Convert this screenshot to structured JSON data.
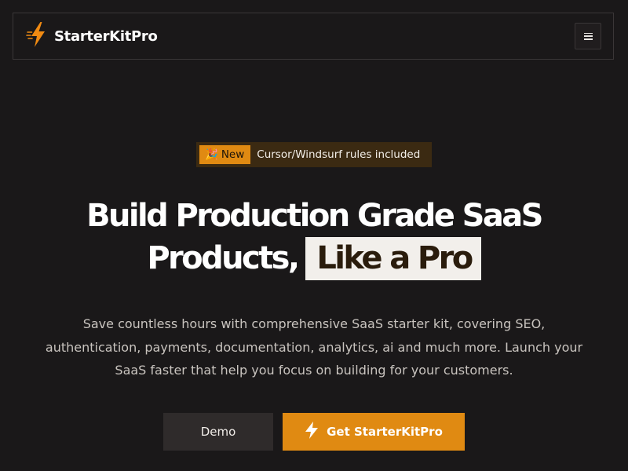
{
  "navbar": {
    "brand_name": "StarterKitPro",
    "menu_icon": "hamburger-menu-icon"
  },
  "badge": {
    "tag_emoji": "🎉",
    "tag_label": "New",
    "text": "Cursor/Windsurf rules included"
  },
  "hero": {
    "headline_line1": "Build Production Grade SaaS",
    "headline_line2_start": "Products,",
    "headline_highlight": "Like a Pro",
    "subtext": "Save countless hours with comprehensive SaaS starter kit, covering SEO, authentication, payments, documentation, analytics, ai and much more. Launch your SaaS faster that help you focus on building for your customers."
  },
  "cta": {
    "demo_label": "Demo",
    "primary_label": "Get StarterKitPro",
    "primary_icon": "lightning-bolt-icon"
  },
  "colors": {
    "background": "#1a1819",
    "accent": "#e08a12",
    "badge_bg": "#3b2a12",
    "highlight_bg": "#f2efeb"
  }
}
